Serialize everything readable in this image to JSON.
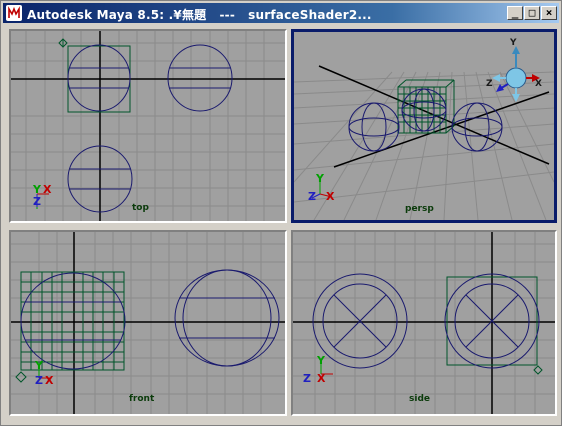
{
  "window": {
    "title": "Autodesk Maya 8.5: .¥無題   ---   surfaceShader2...",
    "minimize_glyph": "_",
    "maximize_glyph": "□",
    "close_glyph": "×"
  },
  "viewports": {
    "top": {
      "label": "top",
      "axis_y": "Y",
      "axis_x": "X",
      "axis_z": "Z"
    },
    "persp": {
      "label": "persp",
      "axis_y": "Y",
      "axis_x": "X",
      "axis_z": "Z"
    },
    "front": {
      "label": "front",
      "axis_y": "Y",
      "axis_x": "X",
      "axis_z": "Z"
    },
    "side": {
      "label": "side",
      "axis_y": "Y",
      "axis_x": "X",
      "axis_z": "Z"
    }
  },
  "view_cube": {
    "label_y": "Y",
    "label_x": "X",
    "label_z": "Z"
  },
  "colors": {
    "viewport_bg": "#a0a0a0",
    "grid": "#8a8a8a",
    "axis": "#000000",
    "wireframe": "#1a1a6e",
    "selection": "#00552a",
    "active_border": "#0a1c6a"
  }
}
